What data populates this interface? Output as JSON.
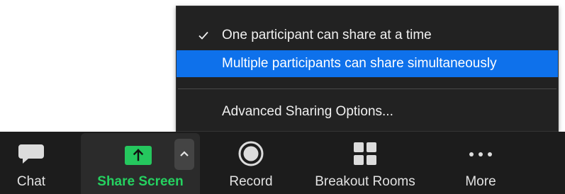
{
  "share_menu": {
    "items": [
      {
        "label": "One participant can share at a time",
        "checked": true,
        "highlighted": false
      },
      {
        "label": "Multiple participants can share simultaneously",
        "checked": false,
        "highlighted": true
      },
      {
        "label": "Advanced Sharing Options...",
        "checked": false,
        "highlighted": false
      }
    ],
    "check_glyph": "✓"
  },
  "toolbar": {
    "chat_label": "Chat",
    "share_screen_label": "Share Screen",
    "record_label": "Record",
    "breakout_rooms_label": "Breakout Rooms",
    "more_label": "More"
  },
  "colors": {
    "menu_bg": "#222222",
    "highlight": "#0e71eb",
    "toolbar_bg": "#1c1c1c",
    "share_green": "#25c75e",
    "share_label_green": "#25d160"
  },
  "icons": [
    "chat-icon",
    "share-screen-icon",
    "chevron-up-icon",
    "record-icon",
    "breakout-rooms-icon",
    "more-icon",
    "checkmark-icon"
  ]
}
